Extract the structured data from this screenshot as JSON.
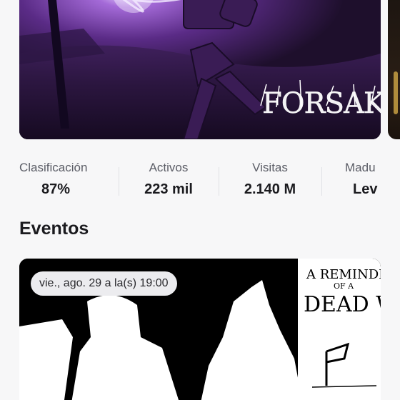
{
  "hero": {
    "title_art": "FORSAKEN"
  },
  "stats": [
    {
      "label": "Clasificación",
      "value": "87%"
    },
    {
      "label": "Activos",
      "value": "223 mil"
    },
    {
      "label": "Visitas",
      "value": "2.140 M"
    },
    {
      "label": "Madu",
      "value": "Lev"
    }
  ],
  "events": {
    "title": "Eventos",
    "card": {
      "date_badge": "vie., ago. 29 a la(s) 19:00",
      "art_line1": "A REMINDER",
      "art_line2": "OF A",
      "art_line3": "DEAD WAR"
    }
  }
}
